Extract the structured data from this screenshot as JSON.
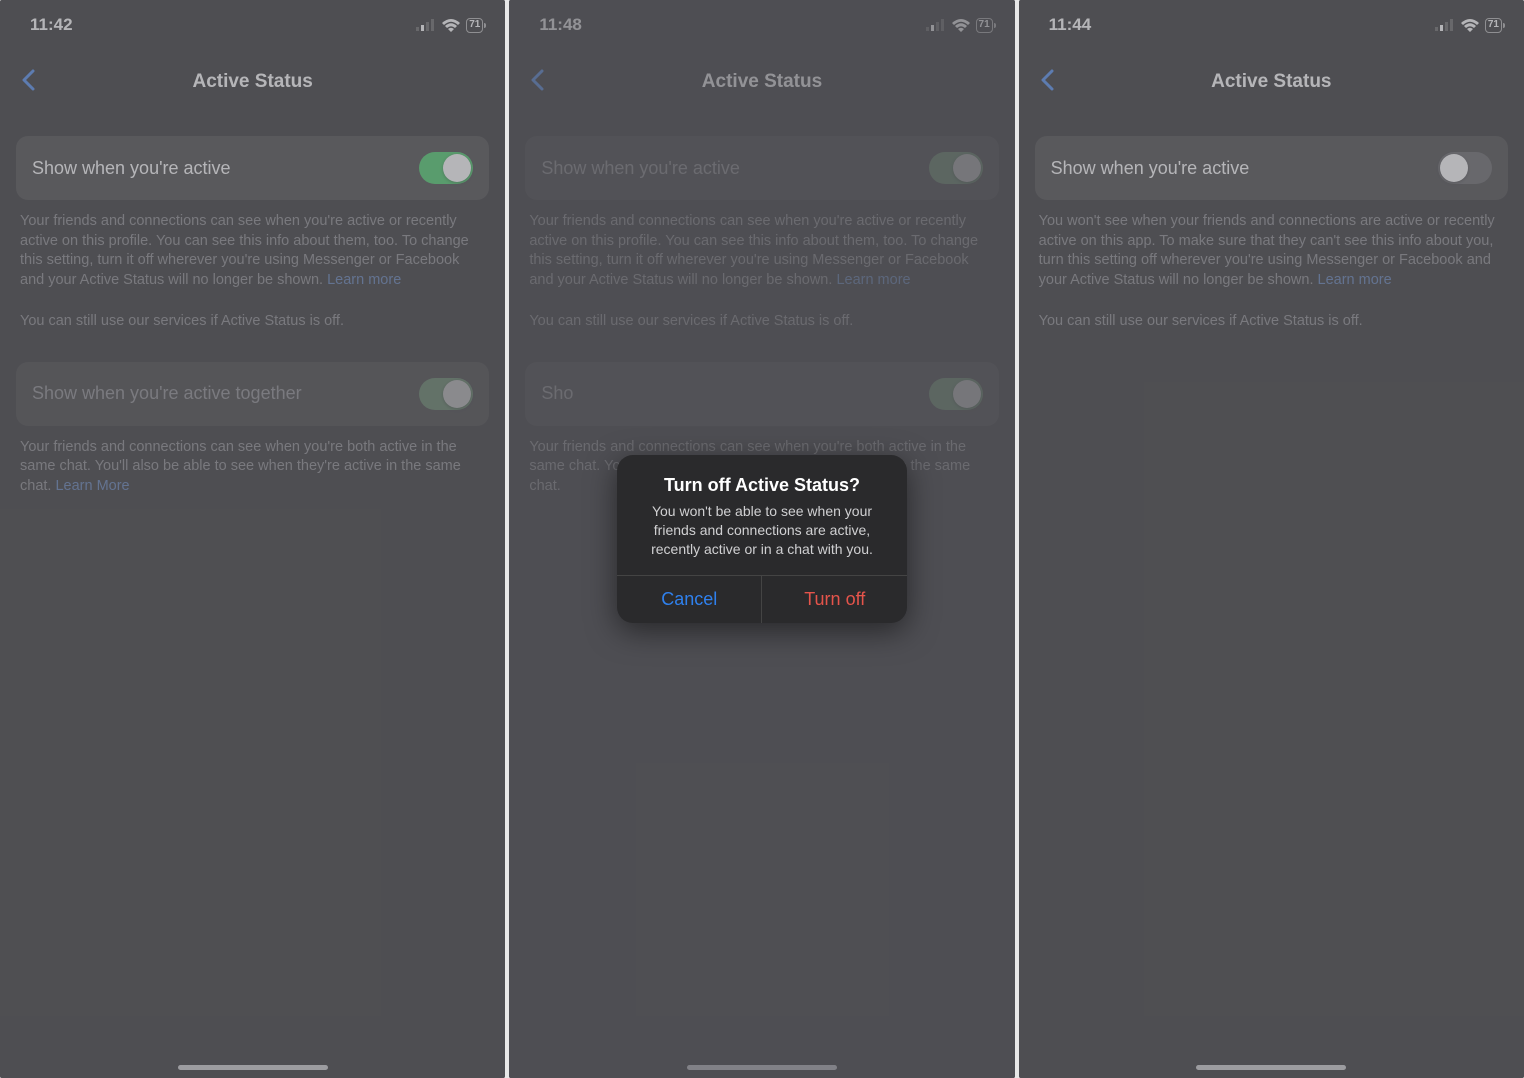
{
  "screens": [
    {
      "time": "11:42",
      "battery": "71",
      "title": "Active Status",
      "row1_label": "Show when you're active",
      "row1_on": true,
      "desc1": "Your friends and connections can see when you're active or recently active on this profile. You can see this info about them, too. To change this setting, turn it off wherever you're using Messenger or Facebook and your Active Status will no longer be shown.",
      "learn1": "Learn more",
      "desc2": "You can still use our services if Active Status is off.",
      "row2_label": "Show when you're active together",
      "row2_on": true,
      "desc3": "Your friends and connections can see when you're both active in the same chat. You'll also be able to see when they're active in the same chat.",
      "learn3": "Learn More"
    },
    {
      "time": "11:48",
      "battery": "71",
      "title": "Active Status",
      "row1_label": "Show when you're active",
      "row1_on": true,
      "desc1": "Your friends and connections can see when you're active or recently active on this profile. You can see this info about them, too. To change this setting, turn it off wherever you're using Messenger or Facebook and your Active Status will no longer be shown.",
      "learn1": "Learn more",
      "desc2": "You can still use our services if Active Status is off.",
      "row2_label": "Sho",
      "row2_on": true,
      "desc3": "Your friends and connections can see when you're both active in the same chat. You'll also be able to see when they're active in the same chat.",
      "alert": {
        "title": "Turn off Active Status?",
        "message": "You won't be able to see when your friends and connections are active, recently active or in a chat with you.",
        "cancel": "Cancel",
        "confirm": "Turn off"
      }
    },
    {
      "time": "11:44",
      "battery": "71",
      "title": "Active Status",
      "row1_label": "Show when you're active",
      "row1_on": false,
      "desc1": "You won't see when your friends and connections are active or recently active on this app. To make sure that they can't see this info about you, turn this setting off wherever you're using Messenger or Facebook and your Active Status will no longer be shown.",
      "learn1": "Learn more",
      "desc2": "You can still use our services if Active Status is off."
    }
  ]
}
